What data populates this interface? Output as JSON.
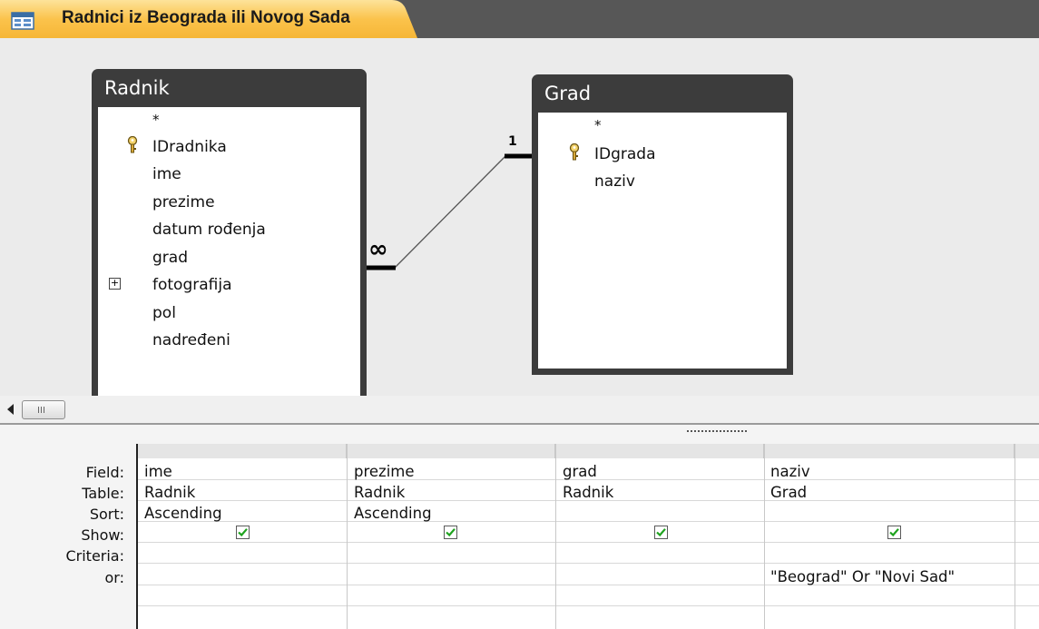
{
  "window": {
    "tab_title": "Radnici iz Beograda ili Novog Sada",
    "tab_icon": "query-design-icon"
  },
  "diagram": {
    "tables": [
      {
        "name": "Radnik",
        "fields": [
          "*",
          "IDradnika",
          "ime",
          "prezime",
          "datum rođenja",
          "grad",
          "fotografija",
          "pol",
          "nadređeni"
        ],
        "key_field": "IDradnika",
        "expandable_field": "fotografija"
      },
      {
        "name": "Grad",
        "fields": [
          "*",
          "IDgrada",
          "naziv"
        ],
        "key_field": "IDgrada"
      }
    ],
    "relationship": {
      "from": "Radnik.grad",
      "to": "Grad.IDgrada",
      "many_label": "∞",
      "one_label": "1"
    }
  },
  "grid": {
    "row_labels": [
      "Field:",
      "Table:",
      "Sort:",
      "Show:",
      "Criteria:",
      "or:"
    ],
    "columns": [
      {
        "field": "ime",
        "table": "Radnik",
        "sort": "Ascending",
        "show": true,
        "criteria": "",
        "or": ""
      },
      {
        "field": "prezime",
        "table": "Radnik",
        "sort": "Ascending",
        "show": true,
        "criteria": "",
        "or": ""
      },
      {
        "field": "grad",
        "table": "Radnik",
        "sort": "",
        "show": true,
        "criteria": "",
        "or": ""
      },
      {
        "field": "naziv",
        "table": "Grad",
        "sort": "",
        "show": true,
        "criteria": "\"Beograd\" Or \"Novi Sad\"",
        "or": ""
      }
    ]
  },
  "colors": {
    "tab_fill": "#fbc34c",
    "tab_bar": "#575757",
    "table_header": "#3c3c3c",
    "checkbox_check": "#1ea31e"
  }
}
